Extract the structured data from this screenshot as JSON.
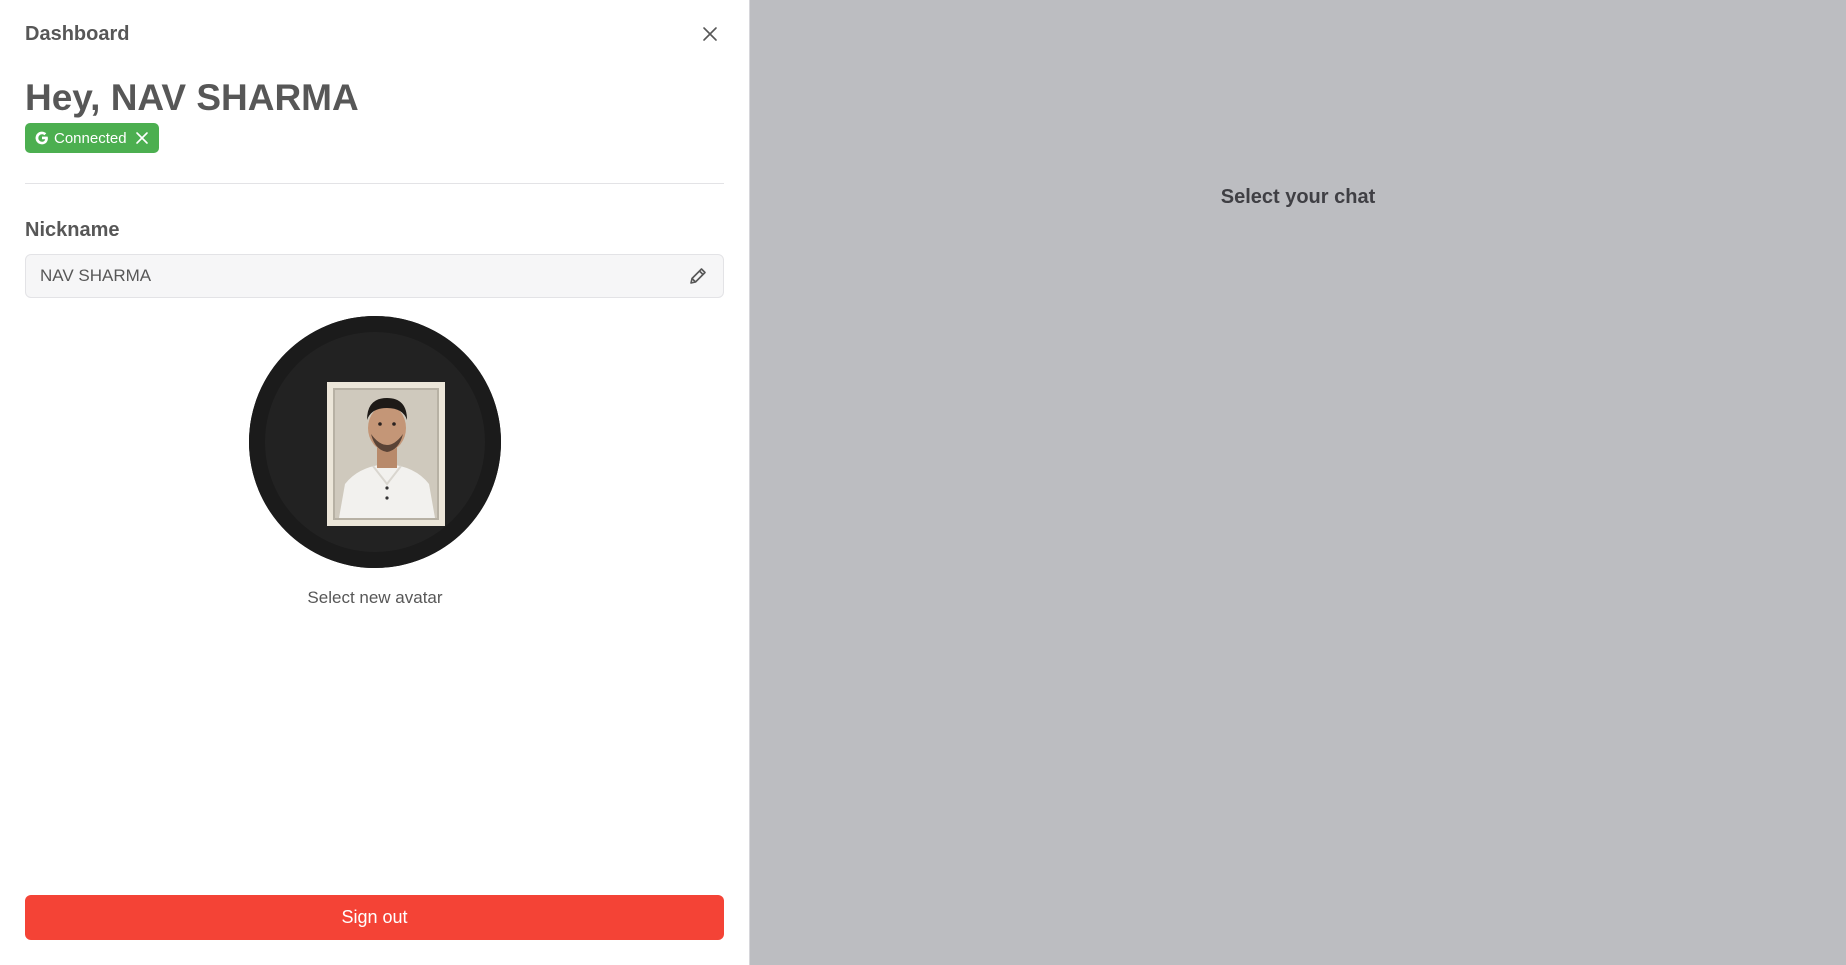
{
  "drawer": {
    "title": "Dashboard",
    "greeting": "Hey, NAV SHARMA",
    "provider_badge": {
      "label": "Connected",
      "icon": "google-icon",
      "color": "#4caf50"
    },
    "nickname": {
      "label": "Nickname",
      "value": "NAV SHARMA"
    },
    "avatar": {
      "caption": "Select new avatar"
    },
    "signout_label": "Sign out",
    "signout_color": "#f44336"
  },
  "main": {
    "empty_message": "Select your chat",
    "background": "#bcbdc1"
  }
}
